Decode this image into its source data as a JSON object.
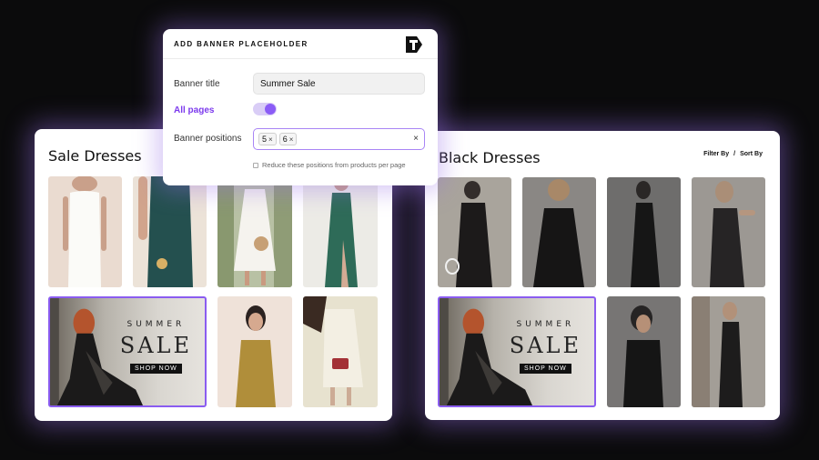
{
  "left_card": {
    "title": "Sale Dresses",
    "banner": {
      "line1": "SUMMER",
      "line2": "SALE",
      "cta": "SHOP NOW"
    }
  },
  "right_card": {
    "title": "Black Dresses",
    "filter_label": "Filter By",
    "separator": "/",
    "sort_label": "Sort By",
    "banner": {
      "line1": "SUMMER",
      "line2": "SALE",
      "cta": "SHOP NOW"
    }
  },
  "dialog": {
    "title": "ADD BANNER PLACEHOLDER",
    "banner_title_label": "Banner title",
    "banner_title_value": "Summer Sale",
    "all_pages_label": "All pages",
    "all_pages_enabled": true,
    "banner_positions_label": "Banner positions",
    "positions": [
      "5",
      "6"
    ],
    "chip_remove": "×",
    "clear": "×",
    "reduce_label": "Reduce these positions from products per page",
    "reduce_checked": false
  },
  "colors": {
    "accent": "#8b5cf6",
    "accent_text": "#7c3aed",
    "glow": "#966ee6",
    "background": "#0b0b0c"
  }
}
